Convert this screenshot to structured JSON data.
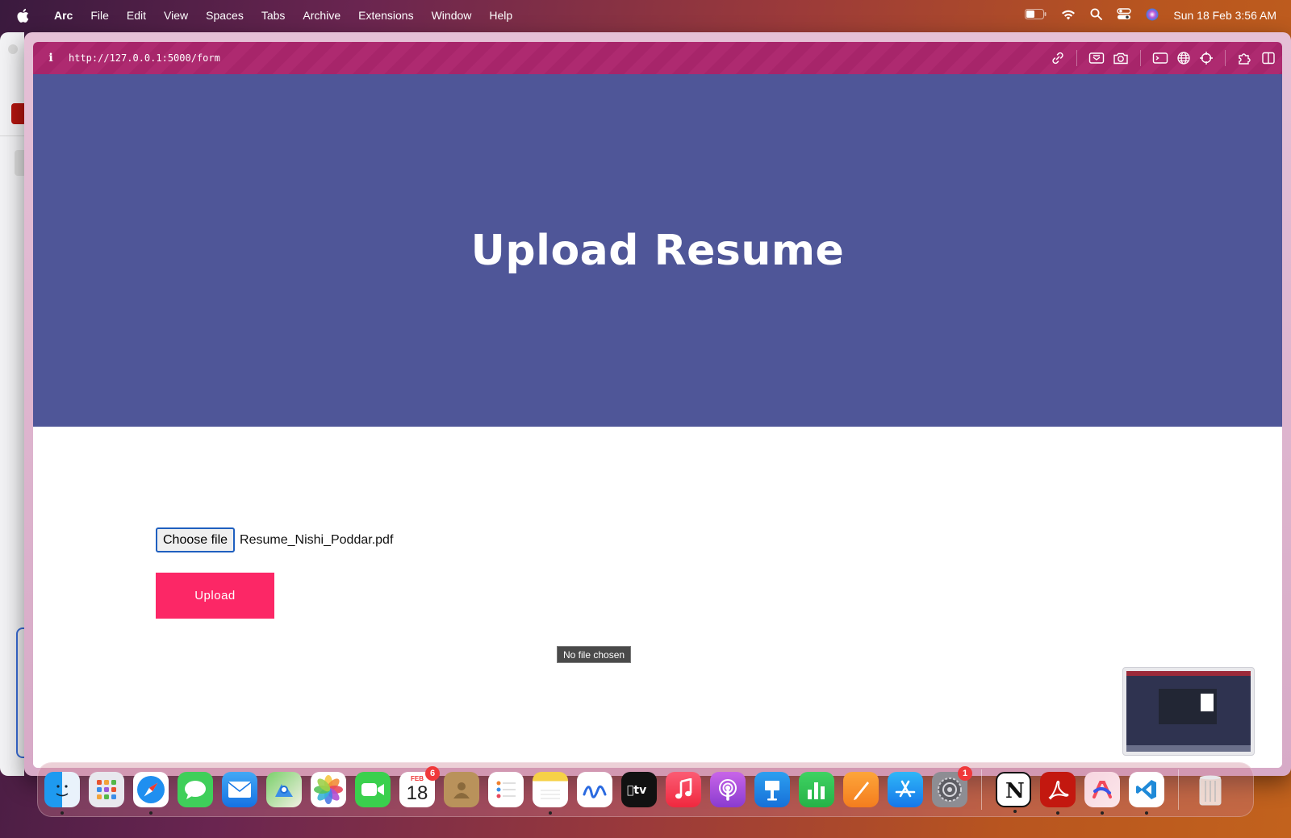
{
  "menubar": {
    "app_name": "Arc",
    "items": [
      "File",
      "Edit",
      "View",
      "Spaces",
      "Tabs",
      "Archive",
      "Extensions",
      "Window",
      "Help"
    ],
    "clock": "Sun 18 Feb  3:56 AM"
  },
  "browser": {
    "url": "http://127.0.0.1:5000/form",
    "info_label": "i"
  },
  "page": {
    "heading": "Upload Resume",
    "choose_file_label": "Choose file",
    "file_name": "Resume_Nishi_Poddar.pdf",
    "upload_label": "Upload",
    "tooltip": "No file chosen"
  },
  "dock": {
    "calendar_month": "FEB",
    "calendar_day": "18",
    "calendar_badge": "6",
    "settings_badge": "1",
    "apps": [
      "Finder",
      "Launchpad",
      "Safari",
      "Messages",
      "Mail",
      "Maps",
      "Photos",
      "FaceTime",
      "Calendar",
      "Contacts",
      "Reminders",
      "Notes",
      "Freeform",
      "TV",
      "Music",
      "Podcasts",
      "Keynote",
      "Numbers",
      "Pages",
      "App Store",
      "System Settings",
      "Notion",
      "Acrobat",
      "Arc",
      "VS Code",
      "Trash"
    ]
  },
  "colors": {
    "hero": "#4f5698",
    "upload_button": "#fc2766",
    "urlbar": "#a7256a"
  }
}
